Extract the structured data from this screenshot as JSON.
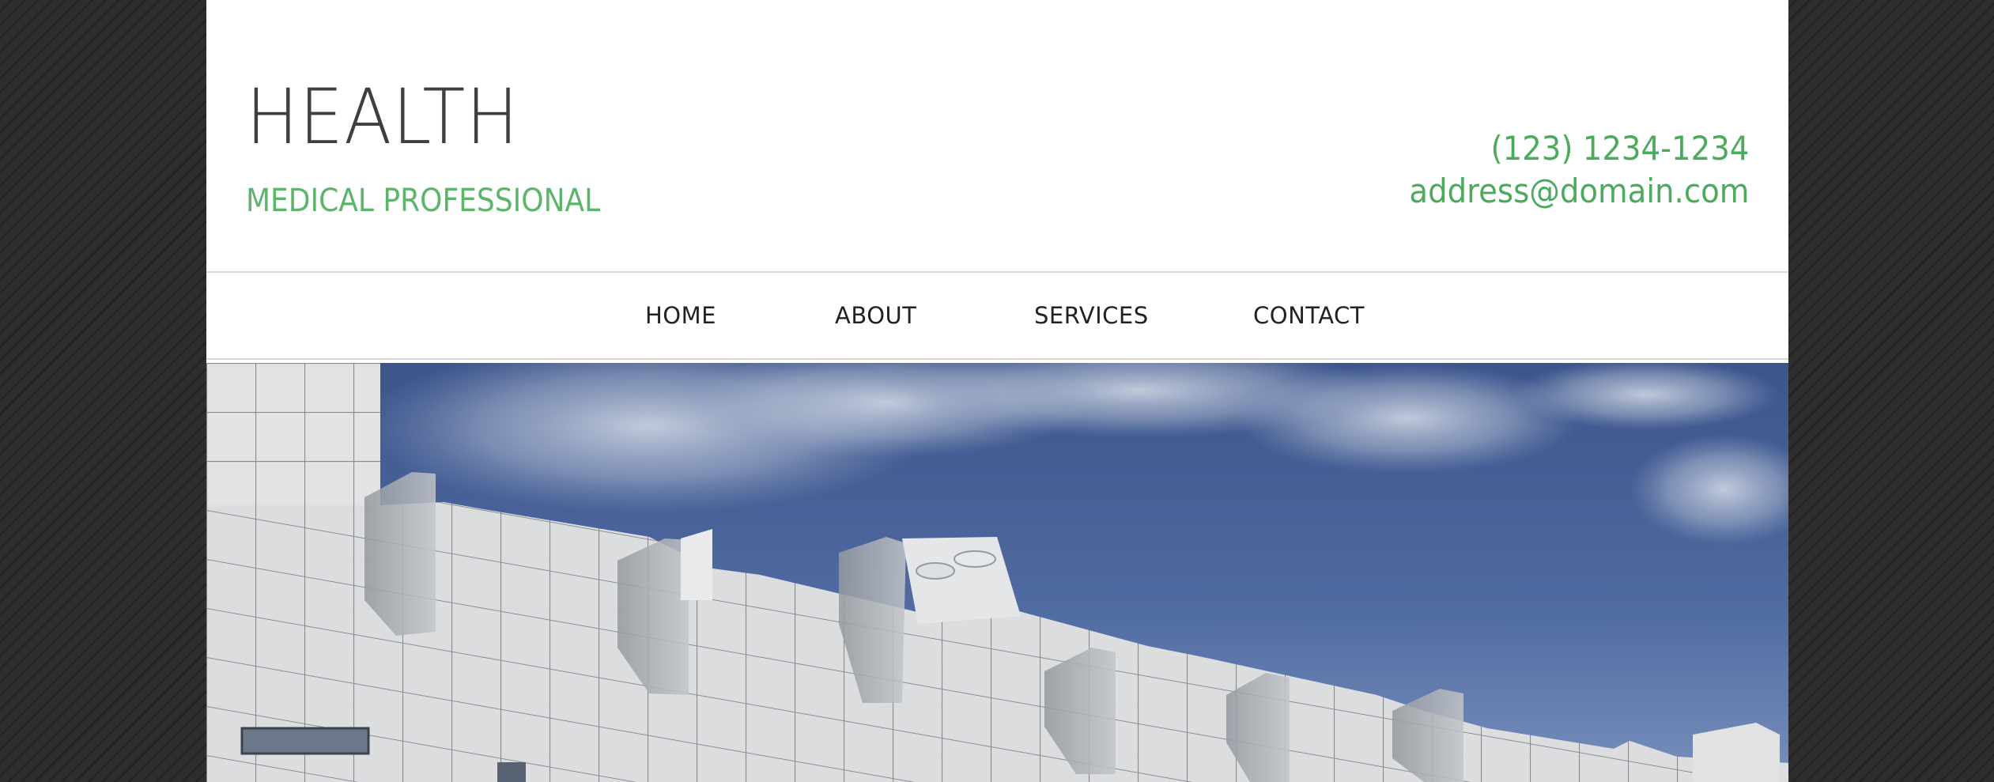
{
  "site": {
    "title": "HEALTH",
    "tagline": "MEDICAL PROFESSIONAL"
  },
  "contact": {
    "phone": "(123) 1234-1234",
    "email": "address@domain.com"
  },
  "nav": {
    "items": [
      {
        "label": "HOME"
      },
      {
        "label": "ABOUT"
      },
      {
        "label": "SERVICES"
      },
      {
        "label": "CONTACT"
      }
    ]
  },
  "hero": {
    "image_subject": "white-modular-building-under-blue-sky"
  },
  "colors": {
    "accent_green": "#5cb56b",
    "title_gray": "#3f3f3f",
    "nav_text": "#222222",
    "backdrop": "#2b2b2b",
    "sky": "#4f6aa3",
    "facade": "#e6e8ea"
  }
}
